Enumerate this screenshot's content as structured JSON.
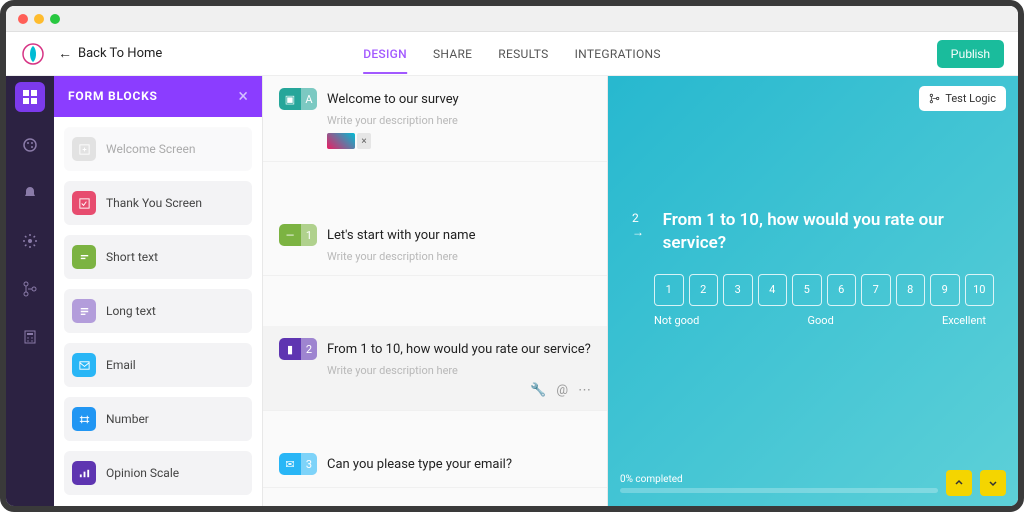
{
  "header": {
    "back_label": "Back To Home",
    "tabs": {
      "design": "DESIGN",
      "share": "SHARE",
      "results": "RESULTS",
      "integrations": "INTEGRATIONS"
    },
    "publish_label": "Publish"
  },
  "blocks_panel": {
    "title": "FORM BLOCKS",
    "items": [
      {
        "label": "Welcome Screen",
        "color": "#bfbfbf"
      },
      {
        "label": "Thank You Screen",
        "color": "#e74c6f"
      },
      {
        "label": "Short text",
        "color": "#7cb342"
      },
      {
        "label": "Long text",
        "color": "#b39ddb"
      },
      {
        "label": "Email",
        "color": "#29b6f6"
      },
      {
        "label": "Number",
        "color": "#2196f3"
      },
      {
        "label": "Opinion Scale",
        "color": "#5e35b1"
      }
    ]
  },
  "editor": {
    "desc_placeholder": "Write your description here",
    "questions": [
      {
        "badge": "A",
        "title": "Welcome to our survey",
        "color": "#26a69a",
        "attach": true
      },
      {
        "badge": "1",
        "title": "Let's start with your name",
        "color": "#7cb342"
      },
      {
        "badge": "2",
        "title": "From 1 to 10, how would you rate our service?",
        "color": "#5e35b1",
        "selected": true,
        "tools": true
      },
      {
        "badge": "3",
        "title": "Can you please type your email?",
        "color": "#29b6f6"
      }
    ]
  },
  "preview": {
    "test_logic_label": "Test Logic",
    "q_number": "2",
    "question": "From 1 to 10, how would you rate our service?",
    "scale": [
      "1",
      "2",
      "3",
      "4",
      "5",
      "6",
      "7",
      "8",
      "9",
      "10"
    ],
    "labels": {
      "left": "Not good",
      "mid": "Good",
      "right": "Excellent"
    },
    "progress_label": "0% completed"
  },
  "colors": {
    "purple": "#8b3dff",
    "teal_grad_a": "#27b8cf",
    "yellow": "#f4d500"
  }
}
